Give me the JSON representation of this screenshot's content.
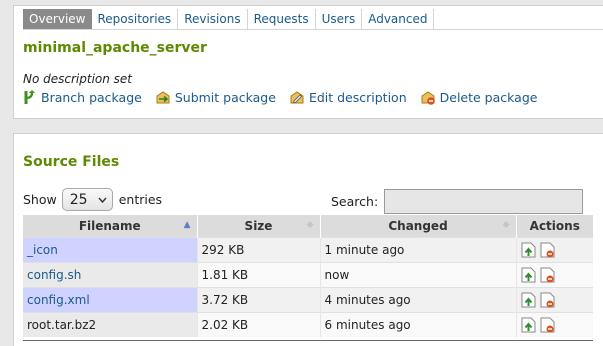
{
  "tabs": [
    {
      "label": "Overview",
      "active": true
    },
    {
      "label": "Repositories",
      "active": false
    },
    {
      "label": "Revisions",
      "active": false
    },
    {
      "label": "Requests",
      "active": false
    },
    {
      "label": "Users",
      "active": false
    },
    {
      "label": "Advanced",
      "active": false
    }
  ],
  "package": {
    "name": "minimal_apache_server",
    "description": "No description set"
  },
  "package_actions": [
    {
      "label": "Branch package",
      "icon": "branch-icon"
    },
    {
      "label": "Submit package",
      "icon": "submit-icon"
    },
    {
      "label": "Edit description",
      "icon": "edit-icon"
    },
    {
      "label": "Delete package",
      "icon": "delete-icon"
    }
  ],
  "source_files": {
    "title": "Source Files",
    "show_label": "Show",
    "page_length": "25",
    "entries_label": "entries",
    "search_label": "Search:",
    "search_value": "",
    "columns": [
      "Filename",
      "Size",
      "Changed",
      "Actions"
    ],
    "rows": [
      {
        "filename": "_icon",
        "link": true,
        "size": "292 KB",
        "changed": "1 minute ago"
      },
      {
        "filename": "config.sh",
        "link": true,
        "size": "1.81 KB",
        "changed": "now"
      },
      {
        "filename": "config.xml",
        "link": true,
        "size": "3.72 KB",
        "changed": "4 minutes ago"
      },
      {
        "filename": "root.tar.bz2",
        "link": false,
        "size": "2.02 KB",
        "changed": "6 minutes ago"
      }
    ]
  },
  "colors": {
    "accent_green": "#5e8a00",
    "link_blue": "#1a5a8c",
    "sorted_column": "#d0d2ff"
  }
}
